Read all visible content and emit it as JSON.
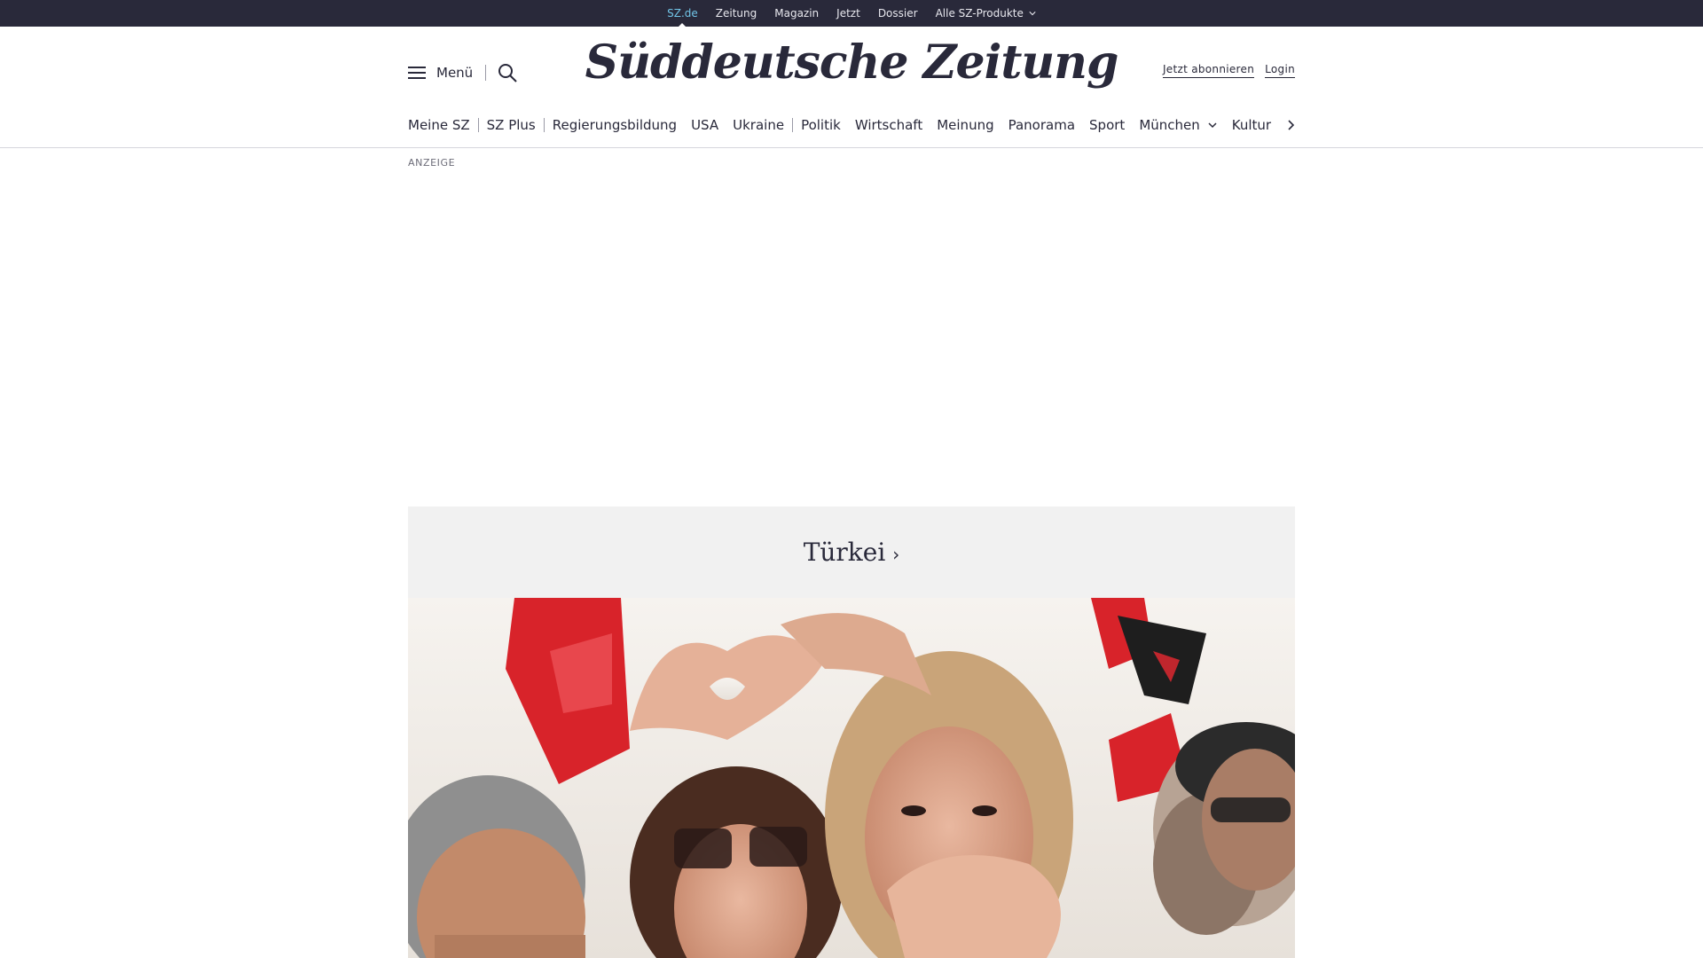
{
  "topbar": {
    "links": [
      {
        "label": "SZ.de",
        "active": true
      },
      {
        "label": "Zeitung"
      },
      {
        "label": "Magazin"
      },
      {
        "label": "Jetzt"
      },
      {
        "label": "Dossier"
      },
      {
        "label": "Alle SZ-Produkte",
        "dropdown": true
      }
    ]
  },
  "header": {
    "menu_label": "Menü",
    "logo_text": "Süddeutsche Zeitung",
    "subscribe_label": "Jetzt abonnieren",
    "login_label": "Login"
  },
  "nav": {
    "items": [
      "Meine SZ",
      "SZ Plus",
      "Regierungsbildung",
      "USA",
      "Ukraine",
      "Politik",
      "Wirtschaft",
      "Meinung",
      "Panorama",
      "Sport",
      "München",
      "Kultur"
    ]
  },
  "ad": {
    "label": "ANZEIGE"
  },
  "teaser": {
    "title": "Türkei",
    "image_alt": "Frauen formen mit den Händen Herzen bei einer Kundgebung mit roten Fahnen"
  },
  "colors": {
    "topbar_bg": "#29293a",
    "active_link": "#71c5e8",
    "text": "#29293a",
    "teaser_bg": "#f1f1f1",
    "flag_red": "#d8232a"
  },
  "icons": {
    "menu": "hamburger-icon",
    "search": "search-icon",
    "dropdown": "chevron-down-icon",
    "nav_scroll": "chevron-right-icon",
    "teaser_arrow": "chevron-right-icon"
  }
}
